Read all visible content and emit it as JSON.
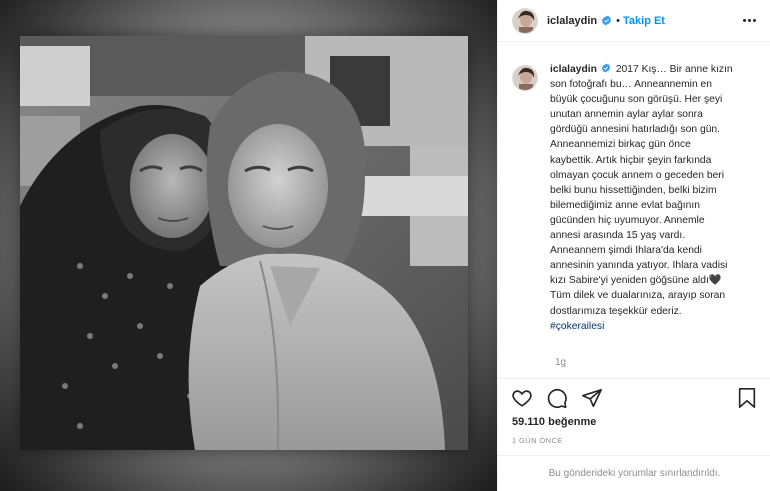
{
  "post": {
    "image_alt": "Black and white photo of two women",
    "image_style": "black-and-white"
  },
  "header": {
    "username": "iclalaydin",
    "separator": "•",
    "follow_label": "Takip Et",
    "more_icon": "more-horizontal-icon",
    "verified_icon": "verified-badge-icon"
  },
  "caption": {
    "username": "iclalaydin",
    "lines": [
      "2017 Kış… Bir anne kızın",
      "son fotoğrafı bu… Anneannemin en",
      "büyük çocuğunu son görüşü. Her şeyi",
      "unutan annemin aylar aylar sonra",
      "gördüğü annesini hatırladığı son gün.",
      "Anneannemizi birkaç gün önce",
      "kaybettik. Artık hiçbir şeyin farkında",
      "olmayan çocuk annem o geceden beri",
      "belki bunu hissettiğinden, belki bizim",
      "bilemediğimiz anne evlat bağının",
      "gücünden hiç uyumuyor. Annemle",
      "annesi arasında 15 yaş vardı.",
      "Anneannem şimdi Ihlara'da kendi",
      "annesinin yanında yatıyor. Ihlara vadisi",
      "kızı Sabire'yi yeniden göğsüne aldı🖤",
      "Tüm dilek ve dualarınıza, arayıp soran",
      "dostlarımıza teşekkür ederiz."
    ],
    "hashtag": "#çokerailesi",
    "time_ago": "1g"
  },
  "actions": {
    "like_icon": "heart-icon",
    "comment_icon": "comment-icon",
    "share_icon": "share-icon",
    "save_icon": "bookmark-icon"
  },
  "likes_text": "59.110 beğenme",
  "post_time": "1 GÜN ÖNCE",
  "comments_limited_text": "Bu gönderideki yorumlar sınırlandırıldı.",
  "colors": {
    "link_blue": "#0095f6",
    "hashtag_blue": "#00376b",
    "text": "#262626",
    "muted": "#8e8e8e",
    "border": "#efefef"
  }
}
